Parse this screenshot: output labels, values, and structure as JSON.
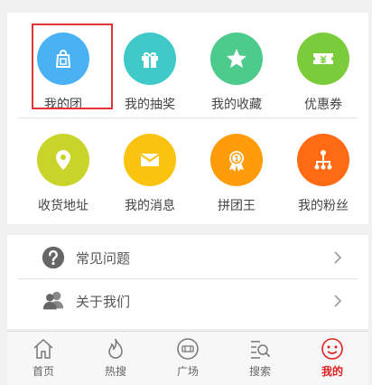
{
  "grid": {
    "items": [
      {
        "label": "我的团",
        "icon": "group-bag-icon",
        "color": "#4ab1f4"
      },
      {
        "label": "我的抽奖",
        "icon": "gift-icon",
        "color": "#3fc9c9"
      },
      {
        "label": "我的收藏",
        "icon": "star-icon",
        "color": "#4dcb8c"
      },
      {
        "label": "优惠券",
        "icon": "coupon-icon",
        "color": "#7bcc3a"
      },
      {
        "label": "收货地址",
        "icon": "location-pin-icon",
        "color": "#c9d42a"
      },
      {
        "label": "我的消息",
        "icon": "envelope-icon",
        "color": "#f9c310"
      },
      {
        "label": "拼团王",
        "icon": "medal-icon",
        "color": "#ff9c0a"
      },
      {
        "label": "我的粉丝",
        "icon": "network-icon",
        "color": "#ff6a12"
      }
    ],
    "selected_index": 0,
    "highlight_color": "#e3333b"
  },
  "list": {
    "items": [
      {
        "label": "常见问题",
        "icon": "question-icon"
      },
      {
        "label": "关于我们",
        "icon": "people-icon"
      }
    ]
  },
  "tabbar": {
    "items": [
      {
        "label": "首页",
        "icon": "home-icon"
      },
      {
        "label": "热搜",
        "icon": "flame-icon"
      },
      {
        "label": "广场",
        "icon": "plaza-icon"
      },
      {
        "label": "搜索",
        "icon": "search-list-icon"
      },
      {
        "label": "我的",
        "icon": "smiley-icon"
      }
    ],
    "active_index": 4,
    "active_color": "#e02020"
  }
}
